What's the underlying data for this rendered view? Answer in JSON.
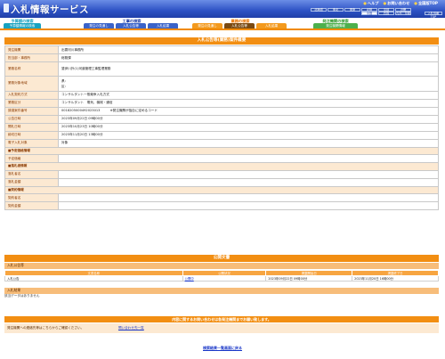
{
  "header": {
    "title": "入札情報サービス",
    "links": [
      "ヘルプ",
      "お問い合わせ",
      "全国版TOP"
    ],
    "regions_row1": [
      "北海道",
      "東北",
      "関東",
      "北陸",
      "中部",
      "近畿"
    ],
    "regions_row2": [
      "中国",
      "四国",
      "九州・沖縄"
    ],
    "selected_region": "中国",
    "toppage": "入札情報TOP"
  },
  "nav": {
    "works": {
      "head": "工事の検索",
      "tabs": [
        "発注の見通し",
        "入札公告等",
        "入札結果"
      ]
    },
    "services": {
      "head": "業務の検索",
      "tabs": [
        "発注の見通し",
        "入札公告等",
        "入札結果"
      ],
      "active": "入札公告等"
    },
    "agencies": {
      "head": "発注機関の検索",
      "tabs": [
        "発注機関情報"
      ]
    },
    "left": {
      "head": "予算額の検索",
      "tab": "予算額情報の検索"
    }
  },
  "detail": {
    "title": "入札公告等(業務)案件概要",
    "rows": {
      "agency": {
        "label": "発注機関",
        "value": "出雲河川事務所"
      },
      "office": {
        "label": "担当部・事務所",
        "value": "総務課"
      },
      "name": {
        "label": "業務名称",
        "value": "斐伊川外(1)河道管理工事監理業務"
      },
      "area": {
        "label": "業務対象地域",
        "value1": "県：",
        "value2": "区："
      },
      "method": {
        "label": "入札契約方式",
        "value": "コンサルタント一般競争入札方式"
      },
      "category": {
        "label": "業務区分",
        "value": "コンサルタント　電気、機械・通信"
      },
      "number": {
        "label": "調達案件番号",
        "value": "0018205000492023013",
        "note": "※発注機関が独自に定めるコード"
      },
      "announce": {
        "label": "公告日時",
        "value": "2023年09月22日 09時00分"
      },
      "opening": {
        "label": "開札日時",
        "value": "2023年10月23日 10時00分"
      },
      "submit": {
        "label": "締切日時",
        "value": "2023年11月20日 13時00分"
      },
      "electronic": {
        "label": "電子入札対象",
        "value": "対象"
      }
    },
    "groups": {
      "planned_price": "予定価格情報",
      "planned_price_label": "予定価格",
      "low_bid": "落札者情報",
      "low_bid_name": "落札者名",
      "low_bid_amount": "落札金額",
      "contract": "契約情報",
      "contract_name": "契約者名",
      "contract_amount": "契約金額"
    }
  },
  "docs": {
    "title": "公開文書",
    "sub1": "入札公告等",
    "columns": [
      "文書名称",
      "公開状況",
      "掲載開始日",
      "掲載終了日"
    ],
    "rows": [
      {
        "name": "入札公告",
        "status": "公開中",
        "start": "2023年09月22日 09時00分",
        "end": "2023年11月20日 16時00分"
      }
    ],
    "sub2": "入札結果",
    "no_data": "該当データはありません"
  },
  "contact": {
    "bar": "内容に関するお問い合わせは各発注機関までお願い致します。",
    "text": "発注機関への連絡先等はこちらからご確認ください。",
    "link": "問い合わせ先一覧"
  },
  "back_link": "検索結果一覧画面に戻る",
  "colors": {
    "header": "#2d52c4",
    "accent": "#f28e12",
    "label_bg": "#fce9d2"
  }
}
